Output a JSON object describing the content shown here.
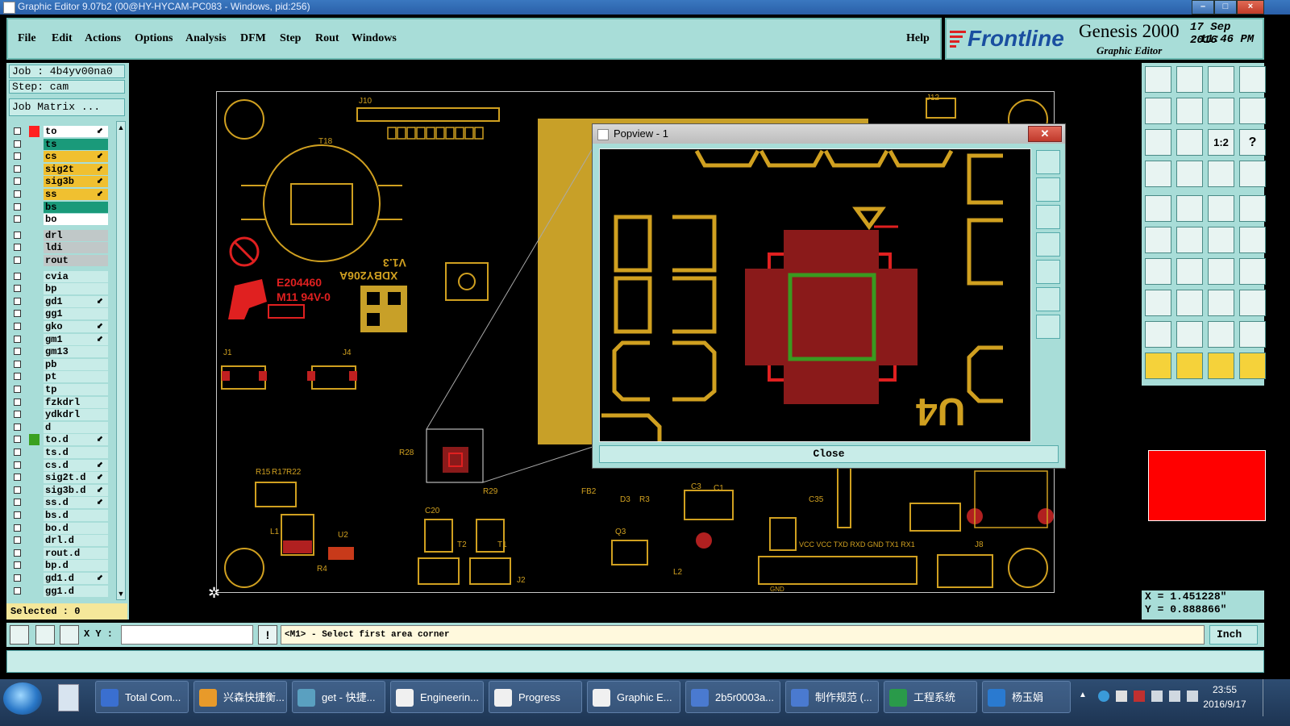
{
  "window": {
    "title": "Graphic Editor 9.07b2 (00@HY-HYCAM-PC083 - Windows, pid:256)"
  },
  "menu": [
    "File",
    "Edit",
    "Actions",
    "Options",
    "Analysis",
    "DFM",
    "Step",
    "Rout",
    "Windows"
  ],
  "help": "Help",
  "brand": {
    "logo": "Frontline",
    "product": "Genesis 2000",
    "subtitle": "Graphic Editor",
    "date": "17 Sep 2016",
    "time": "11:46 PM"
  },
  "job": {
    "job": "Job : 4b4yv00na0",
    "step": "Step: cam",
    "matrix": "Job Matrix ..."
  },
  "layers": [
    {
      "name": "to",
      "color": "#ffffff",
      "swatch": "#ff2020",
      "arrow": true
    },
    {
      "name": "ts",
      "color": "#1a9a7a",
      "swatch": "",
      "arrow": false
    },
    {
      "name": "cs",
      "color": "#f0c030",
      "swatch": "",
      "arrow": true
    },
    {
      "name": "sig2t",
      "color": "#f0c030",
      "swatch": "",
      "arrow": true
    },
    {
      "name": "sig3b",
      "color": "#f0c030",
      "swatch": "",
      "arrow": true
    },
    {
      "name": "ss",
      "color": "#f0c030",
      "swatch": "",
      "arrow": true
    },
    {
      "name": "bs",
      "color": "#1a9a7a",
      "swatch": "",
      "arrow": false
    },
    {
      "name": "bo",
      "color": "#ffffff",
      "swatch": "",
      "arrow": false
    },
    {
      "name": "drl",
      "color": "#c0c8c8",
      "swatch": "",
      "arrow": false
    },
    {
      "name": "ldi",
      "color": "#c0c8c8",
      "swatch": "",
      "arrow": false
    },
    {
      "name": "rout",
      "color": "#c0c8c8",
      "swatch": "",
      "arrow": false
    },
    {
      "name": "cvia",
      "color": "#c8ece8",
      "swatch": "",
      "arrow": false
    },
    {
      "name": "bp",
      "color": "#c8ece8",
      "swatch": "",
      "arrow": false
    },
    {
      "name": "gd1",
      "color": "#c8ece8",
      "swatch": "",
      "arrow": true
    },
    {
      "name": "gg1",
      "color": "#c8ece8",
      "swatch": "",
      "arrow": false
    },
    {
      "name": "gko",
      "color": "#c8ece8",
      "swatch": "",
      "arrow": true
    },
    {
      "name": "gm1",
      "color": "#c8ece8",
      "swatch": "",
      "arrow": true
    },
    {
      "name": "gm13",
      "color": "#c8ece8",
      "swatch": "",
      "arrow": false
    },
    {
      "name": "pb",
      "color": "#c8ece8",
      "swatch": "",
      "arrow": false
    },
    {
      "name": "pt",
      "color": "#c8ece8",
      "swatch": "",
      "arrow": false
    },
    {
      "name": "tp",
      "color": "#c8ece8",
      "swatch": "",
      "arrow": false
    },
    {
      "name": "fzkdrl",
      "color": "#c8ece8",
      "swatch": "",
      "arrow": false
    },
    {
      "name": "ydkdrl",
      "color": "#c8ece8",
      "swatch": "",
      "arrow": false
    },
    {
      "name": "d",
      "color": "#c8ece8",
      "swatch": "",
      "arrow": false
    },
    {
      "name": "to.d",
      "color": "#c8ece8",
      "swatch": "#3aa020",
      "arrow": true
    },
    {
      "name": "ts.d",
      "color": "#c8ece8",
      "swatch": "",
      "arrow": false
    },
    {
      "name": "cs.d",
      "color": "#c8ece8",
      "swatch": "",
      "arrow": true
    },
    {
      "name": "sig2t.d",
      "color": "#c8ece8",
      "swatch": "",
      "arrow": true
    },
    {
      "name": "sig3b.d",
      "color": "#c8ece8",
      "swatch": "",
      "arrow": true
    },
    {
      "name": "ss.d",
      "color": "#c8ece8",
      "swatch": "",
      "arrow": true
    },
    {
      "name": "bs.d",
      "color": "#c8ece8",
      "swatch": "",
      "arrow": false
    },
    {
      "name": "bo.d",
      "color": "#c8ece8",
      "swatch": "",
      "arrow": false
    },
    {
      "name": "drl.d",
      "color": "#c8ece8",
      "swatch": "",
      "arrow": false
    },
    {
      "name": "rout.d",
      "color": "#c8ece8",
      "swatch": "",
      "arrow": false
    },
    {
      "name": "bp.d",
      "color": "#c8ece8",
      "swatch": "",
      "arrow": false
    },
    {
      "name": "gd1.d",
      "color": "#c8ece8",
      "swatch": "",
      "arrow": true
    },
    {
      "name": "gg1.d",
      "color": "#c8ece8",
      "swatch": "",
      "arrow": false
    }
  ],
  "selected": "Selected : 0",
  "popview": {
    "title": "Popview - 1",
    "close": "Close",
    "pad_label": "U4"
  },
  "board_labels": {
    "cert": "E204460",
    "cert2": "M11 94V-0",
    "pcb_id": "XDBY206A",
    "version": "V1.3",
    "j10": "J10",
    "j12": "J12",
    "t18": "T18",
    "j1": "J1",
    "j4": "J4",
    "j8": "J8",
    "j2": "J2",
    "l1": "L1",
    "r15": "R15",
    "r17": "R17",
    "r22": "R22",
    "c20": "C20",
    "t2": "T2",
    "q3": "Q3",
    "l2": "L2",
    "d3": "D3",
    "r3": "R3",
    "r4": "R4",
    "t1": "T1",
    "u2": "U2",
    "r28": "R28",
    "r29": "R29",
    "c35": "C35",
    "c1": "C1",
    "c3": "C3",
    "fb2": "FB2",
    "pins": "VCC  VCC  TXD  RXD  GND  TX1  RX1",
    "gnd": "GND"
  },
  "coords": {
    "x": "X = 1.451228\"",
    "y": "Y = 0.888866\""
  },
  "command": {
    "xy_label": "X Y :",
    "message": "<M1> - Select first area corner",
    "units": "Inch"
  },
  "taskbar": {
    "tasks": [
      {
        "label": "Total Com...",
        "color": "#3a6fd0"
      },
      {
        "label": "兴森快捷衡...",
        "color": "#e89a2a"
      },
      {
        "label": "get - 快捷...",
        "color": "#5aa0c0"
      },
      {
        "label": "Engineerin...",
        "color": "#f0f0f0"
      },
      {
        "label": "Progress",
        "color": "#f0f0f0"
      },
      {
        "label": "Graphic E...",
        "color": "#f0f0f0"
      },
      {
        "label": "2b5r0003a...",
        "color": "#4a7ad0"
      },
      {
        "label": "制作规范 (...",
        "color": "#4a7ad0"
      },
      {
        "label": "工程系统",
        "color": "#2a9a4a"
      },
      {
        "label": "杨玉娟",
        "color": "#2a7ad0"
      }
    ],
    "time": "23:55",
    "date": "2016/9/17"
  }
}
